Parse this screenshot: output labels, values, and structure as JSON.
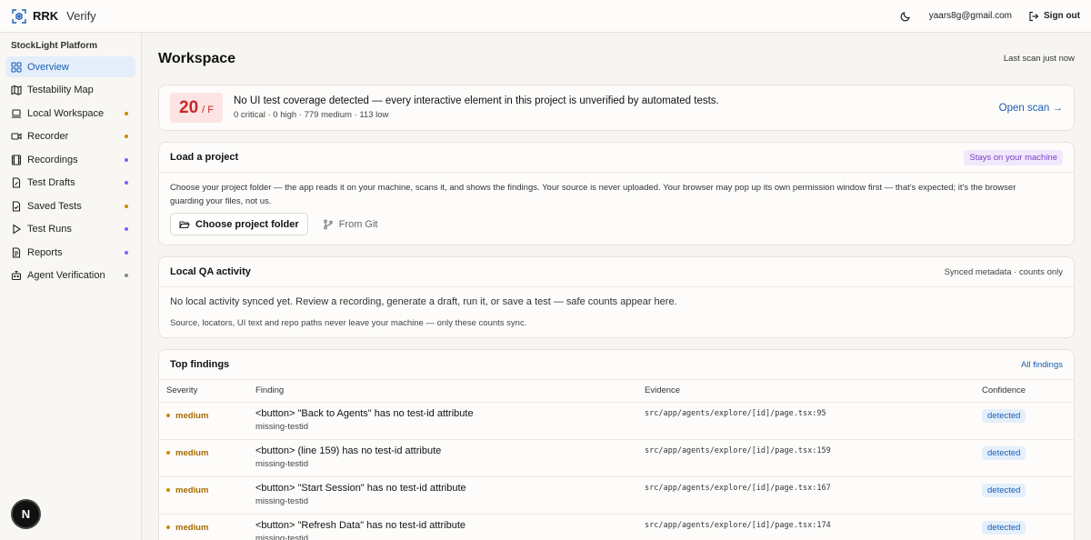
{
  "brand": {
    "name": "RRK",
    "sub": "Verify"
  },
  "topbar": {
    "email": "yaars8g@gmail.com",
    "signout": "Sign out"
  },
  "sidebar": {
    "heading": "StockLight Platform",
    "items": [
      {
        "label": "Overview",
        "icon": "grid-icon",
        "active": true,
        "dot": ""
      },
      {
        "label": "Testability Map",
        "icon": "map-icon",
        "active": false,
        "dot": ""
      },
      {
        "label": "Local Workspace",
        "icon": "laptop-icon",
        "active": false,
        "dot": "#c98b00"
      },
      {
        "label": "Recorder",
        "icon": "video-icon",
        "active": false,
        "dot": "#c98b00"
      },
      {
        "label": "Recordings",
        "icon": "film-icon",
        "active": false,
        "dot": "#8a5cf6"
      },
      {
        "label": "Test Drafts",
        "icon": "file-edit-icon",
        "active": false,
        "dot": "#8a5cf6"
      },
      {
        "label": "Saved Tests",
        "icon": "file-check-icon",
        "active": false,
        "dot": "#c98b00"
      },
      {
        "label": "Test Runs",
        "icon": "play-icon",
        "active": false,
        "dot": "#8a5cf6"
      },
      {
        "label": "Reports",
        "icon": "report-icon",
        "active": false,
        "dot": "#8a5cf6"
      },
      {
        "label": "Agent Verification",
        "icon": "bot-icon",
        "active": false,
        "dot": "#888888"
      }
    ],
    "avatar": "N"
  },
  "page": {
    "title": "Workspace",
    "last_scan": "Last scan just now"
  },
  "score": {
    "value": "20",
    "grade": "/ F",
    "title": "No UI test coverage detected — every interactive element in this project is unverified by automated tests.",
    "summary": "0 critical · 0 high · 779 medium · 113 low",
    "open": "Open scan →"
  },
  "load": {
    "title": "Load a project",
    "badge": "Stays on your machine",
    "description": "Choose your project folder — the app reads it on your machine, scans it, and shows the findings. Your source is never uploaded. Your browser may pop up its own permission window first — that's expected; it's the browser guarding your files, not us.",
    "choose": "Choose project folder",
    "git": "From Git"
  },
  "qa": {
    "title": "Local QA activity",
    "meta": "Synced metadata · counts only",
    "message": "No local activity synced yet. Review a recording, generate a draft, run it, or save a test — safe counts appear here.",
    "note": "Source, locators, UI text and repo paths never leave your machine — only these counts sync."
  },
  "findings": {
    "title": "Top findings",
    "link": "All findings",
    "columns": [
      "Severity",
      "Finding",
      "Evidence",
      "Confidence"
    ],
    "rows": [
      {
        "severity": "medium",
        "title": "<button> \"Back to Agents\" has no test-id attribute",
        "code": "missing-testid",
        "evidence": "src/app/agents/explore/[id]/page.tsx:95",
        "confidence": "detected"
      },
      {
        "severity": "medium",
        "title": "<button> (line 159) has no test-id attribute",
        "code": "missing-testid",
        "evidence": "src/app/agents/explore/[id]/page.tsx:159",
        "confidence": "detected"
      },
      {
        "severity": "medium",
        "title": "<button> \"Start Session\" has no test-id attribute",
        "code": "missing-testid",
        "evidence": "src/app/agents/explore/[id]/page.tsx:167",
        "confidence": "detected"
      },
      {
        "severity": "medium",
        "title": "<button> \"Refresh Data\" has no test-id attribute",
        "code": "missing-testid",
        "evidence": "src/app/agents/explore/[id]/page.tsx:174",
        "confidence": "detected"
      }
    ]
  }
}
